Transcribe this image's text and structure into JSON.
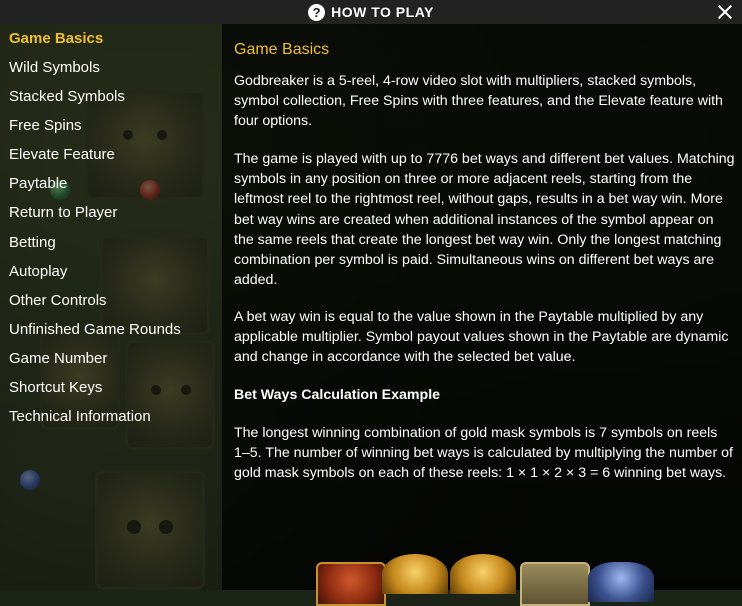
{
  "header": {
    "title": "HOW TO PLAY",
    "help_icon": "question-circle-icon",
    "close_icon": "close-icon"
  },
  "sidebar": {
    "active_color": "#f0bf2e",
    "items": [
      {
        "label": "Game Basics",
        "active": true
      },
      {
        "label": "Wild Symbols"
      },
      {
        "label": "Stacked Symbols"
      },
      {
        "label": "Free Spins"
      },
      {
        "label": "Elevate Feature"
      },
      {
        "label": "Paytable"
      },
      {
        "label": "Return to Player"
      },
      {
        "label": "Betting"
      },
      {
        "label": "Autoplay"
      },
      {
        "label": "Other Controls"
      },
      {
        "label": "Unfinished Game Rounds"
      },
      {
        "label": "Game Number"
      },
      {
        "label": "Shortcut Keys"
      },
      {
        "label": "Technical Information"
      }
    ]
  },
  "content": {
    "title": "Game Basics",
    "paragraphs": [
      "Godbreaker is a 5-reel, 4-row video slot with multipliers, stacked symbols, symbol collection, Free Spins with three features, and the Elevate feature with four options.",
      "The game is played with up to 7776 bet ways and different bet values. Matching symbols in any position on three or more adjacent reels, starting from the leftmost reel to the rightmost reel, without gaps, results in a bet way win. More bet way wins are created when additional instances of the symbol appear on the same reels that create the longest bet way win. Only the longest matching combination per symbol is paid. Simultaneous wins on different bet ways are added.",
      "A bet way win is equal to the value shown in the Paytable multiplied by any applicable multiplier. Symbol payout values shown in the Paytable are dynamic and change in accordance with the selected bet value."
    ],
    "subheading": "Bet Ways Calculation Example",
    "example": "The longest winning combination of gold mask symbols is 7 symbols on reels 1–5. The number of winning bet ways is calculated by multiplying the number of gold mask symbols on each of these reels: 1 × 1 × 2 × 3 = 6 winning bet ways."
  }
}
